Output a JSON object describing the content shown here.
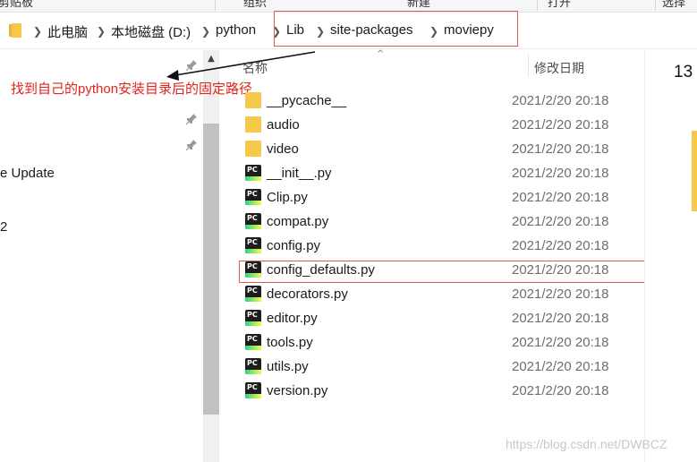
{
  "ribbon": {
    "items": [
      "剪贴板",
      "组织",
      "新建",
      "打开",
      "选择"
    ]
  },
  "breadcrumb": {
    "items": [
      "此电脑",
      "本地磁盘 (D:)",
      "python",
      "Lib",
      "site-packages",
      "moviepy"
    ]
  },
  "annotation": {
    "text": "找到自己的python安装目录后的固定路径",
    "color": "#e2231a"
  },
  "nav": {
    "items": [
      "e Update",
      "2"
    ]
  },
  "columns": {
    "name": "名称",
    "date": "修改日期"
  },
  "files": [
    {
      "name": "__pycache__",
      "date": "2021/2/20 20:18",
      "type": "folder"
    },
    {
      "name": "audio",
      "date": "2021/2/20 20:18",
      "type": "folder"
    },
    {
      "name": "video",
      "date": "2021/2/20 20:18",
      "type": "folder"
    },
    {
      "name": "__init__.py",
      "date": "2021/2/20 20:18",
      "type": "py"
    },
    {
      "name": "Clip.py",
      "date": "2021/2/20 20:18",
      "type": "py"
    },
    {
      "name": "compat.py",
      "date": "2021/2/20 20:18",
      "type": "py"
    },
    {
      "name": "config.py",
      "date": "2021/2/20 20:18",
      "type": "py"
    },
    {
      "name": "config_defaults.py",
      "date": "2021/2/20 20:18",
      "type": "py"
    },
    {
      "name": "decorators.py",
      "date": "2021/2/20 20:18",
      "type": "py"
    },
    {
      "name": "editor.py",
      "date": "2021/2/20 20:18",
      "type": "py"
    },
    {
      "name": "tools.py",
      "date": "2021/2/20 20:18",
      "type": "py"
    },
    {
      "name": "utils.py",
      "date": "2021/2/20 20:18",
      "type": "py"
    },
    {
      "name": "version.py",
      "date": "2021/2/20 20:18",
      "type": "py"
    }
  ],
  "right_pane": {
    "value": "13"
  },
  "watermark": "https://blog.csdn.net/DWBCZ",
  "colors": {
    "highlight": "#e05a5a",
    "folder": "#f6c94a"
  },
  "py_icon_label": "PC"
}
